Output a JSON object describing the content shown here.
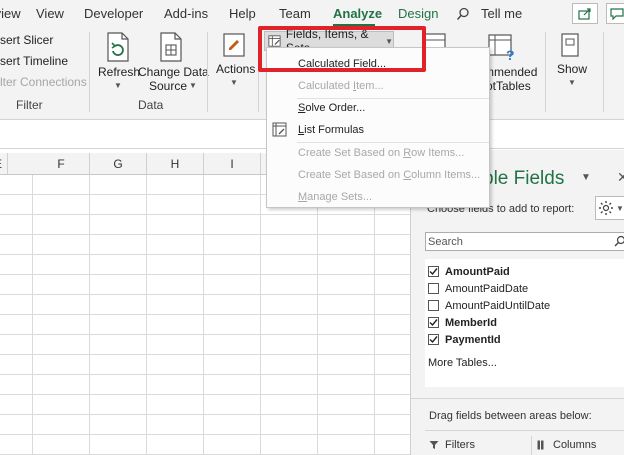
{
  "colors": {
    "accent": "#217346",
    "highlight": "#e02229"
  },
  "tabs": [
    {
      "label": "Review"
    },
    {
      "label": "View"
    },
    {
      "label": "Developer"
    },
    {
      "label": "Add-ins"
    },
    {
      "label": "Help"
    },
    {
      "label": "Team"
    },
    {
      "label": "Analyze",
      "active": true
    },
    {
      "label": "Design"
    }
  ],
  "tell_me": "Tell me",
  "ribbon": {
    "filter_group": {
      "insert_slicer": "sert Slicer",
      "insert_timeline": "sert Timeline",
      "filter_connections": "lter Connections",
      "label": "Filter"
    },
    "data_group": {
      "refresh": "Refresh",
      "change_source_1": "Change Data",
      "change_source_2": "Source",
      "label": "Data"
    },
    "actions": "Actions",
    "fields_items_sets": "Fields, Items, & Sets",
    "recommended_1": "mmended",
    "recommended_2": "otTables",
    "show": "Show"
  },
  "menu": {
    "items": [
      {
        "pre": "Calculated ",
        "key": "F",
        "post": "ield...",
        "enabled": true
      },
      {
        "pre": "Calculated ",
        "key": "I",
        "post": "tem...",
        "enabled": false
      },
      {
        "pre": "",
        "key": "S",
        "post": "olve Order...",
        "enabled": true
      },
      {
        "pre": "",
        "key": "L",
        "post": "ist Formulas",
        "enabled": true
      },
      {
        "pre": "Create Set Based on ",
        "key": "R",
        "post": "ow Items...",
        "enabled": false
      },
      {
        "pre": "Create Set Based on ",
        "key": "C",
        "post": "olumn Items...",
        "enabled": false
      },
      {
        "pre": "",
        "key": "M",
        "post": "anage Sets...",
        "enabled": false
      }
    ]
  },
  "sheet": {
    "columns": [
      "E",
      "F",
      "G",
      "H",
      "I"
    ]
  },
  "pane": {
    "title": "ble Fields",
    "choose_label": "Choose fields to add to report:",
    "search_placeholder": "Search",
    "fields": [
      {
        "name": "AmountPaid",
        "checked": true
      },
      {
        "name": "AmountPaidDate",
        "checked": false
      },
      {
        "name": "AmountPaidUntilDate",
        "checked": false
      },
      {
        "name": "MemberId",
        "checked": true
      },
      {
        "name": "PaymentId",
        "checked": true
      }
    ],
    "more_tables": "More Tables...",
    "drag_label": "Drag fields between areas below:",
    "areas": {
      "filters": "Filters",
      "columns": "Columns"
    }
  }
}
